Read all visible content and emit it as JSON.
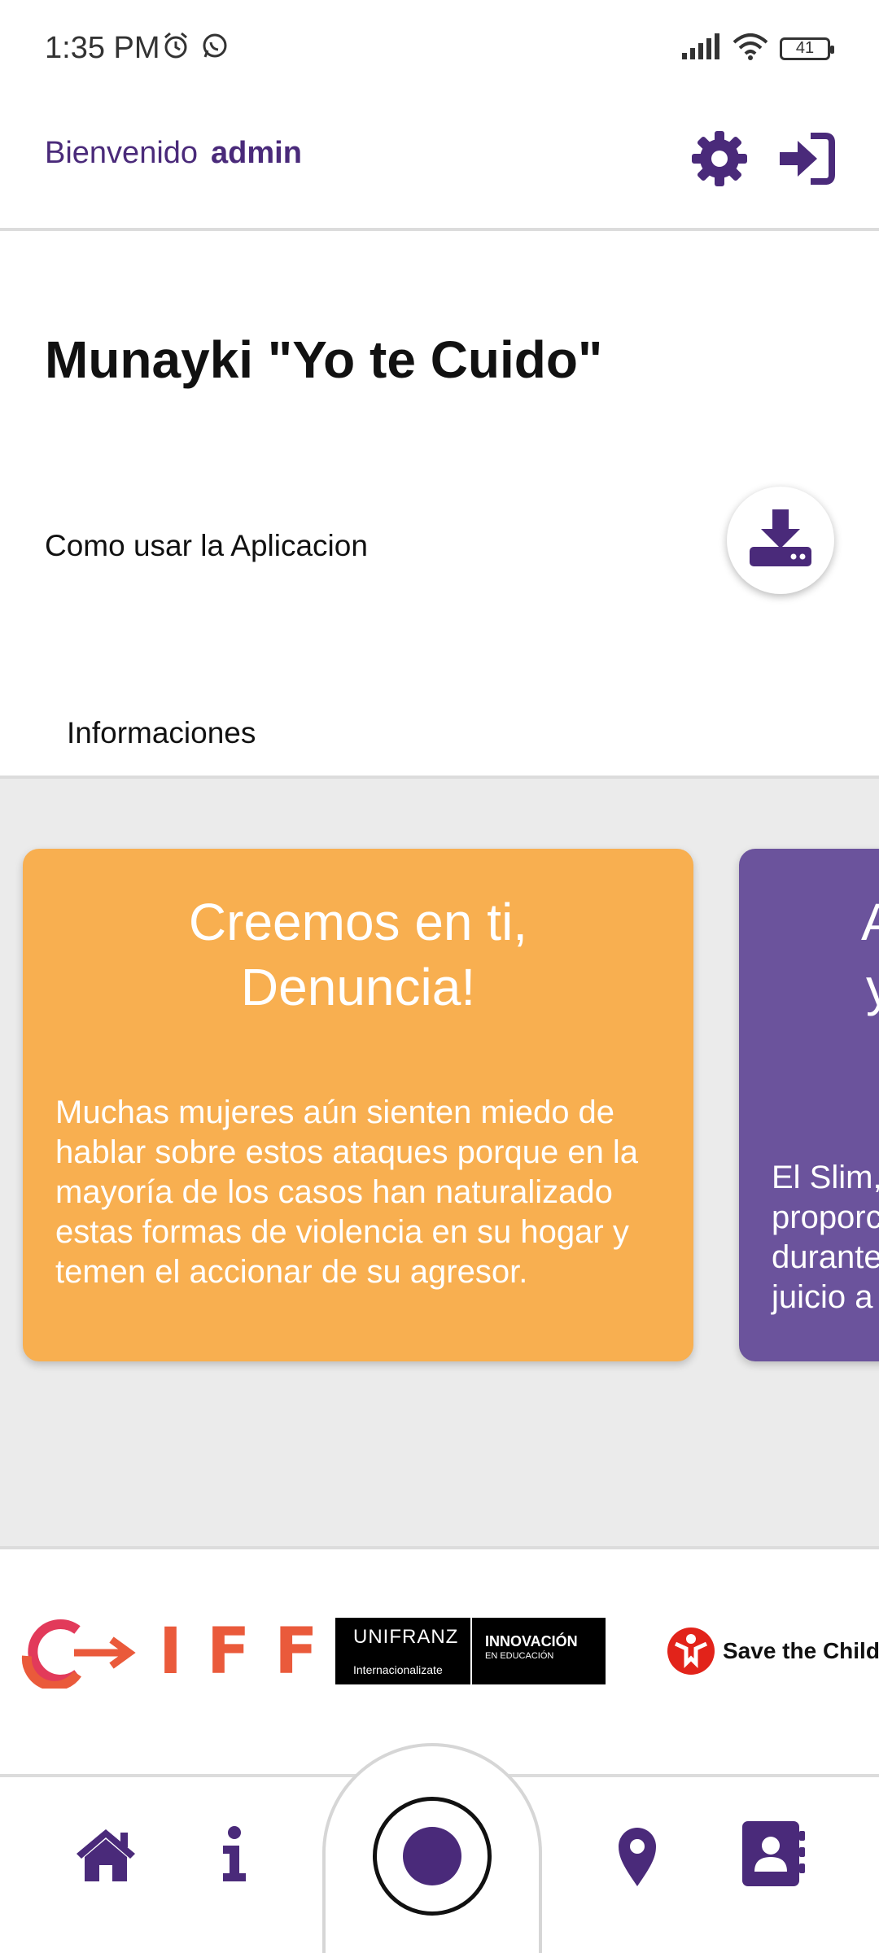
{
  "status_bar": {
    "time": "1:35 PM",
    "battery": "41",
    "icons_left": [
      "alarm-icon",
      "whatsapp-icon"
    ],
    "icons_right": [
      "signal-icon",
      "wifi-icon",
      "battery-icon"
    ]
  },
  "header": {
    "welcome": "Bienvenido",
    "username": "admin",
    "icons": [
      "gear-icon",
      "logout-icon"
    ]
  },
  "main": {
    "title": "Munayki \"Yo te Cuido\"",
    "howto_label": "Como usar la Aplicacion",
    "download_icon": "download-icon",
    "tab_label": "Informaciones"
  },
  "cards": [
    {
      "title": "Creemos en ti, Denuncia!",
      "body": "Muchas mujeres aún sienten miedo de hablar sobre estos ataques porque en la mayoría de los casos han naturalizado estas formas de violencia en su hogar y temen el accionar de su agresor."
    },
    {
      "title_lines": [
        "A",
        "y"
      ],
      "body_lines": [
        "El Slim,",
        "proporc",
        "durante",
        "juicio a"
      ]
    }
  ],
  "logos": {
    "iff": "IFF",
    "unifranz": {
      "name": "UNIFRANZ",
      "sub": "Internacionalizate",
      "right_main": "INNOVACIÓN",
      "right_sub": "EN EDUCACIÓN"
    },
    "stc": "Save the Childre"
  },
  "bottom_nav": {
    "items": [
      "home-icon",
      "info-icon",
      "sos-button",
      "location-icon",
      "contacts-icon"
    ]
  },
  "colors": {
    "primary": "#4a2a7a",
    "card_orange": "#f8af50",
    "card_purple": "#6b539c",
    "background_gray": "#ebebeb",
    "iff_orange": "#ea5a3b"
  }
}
